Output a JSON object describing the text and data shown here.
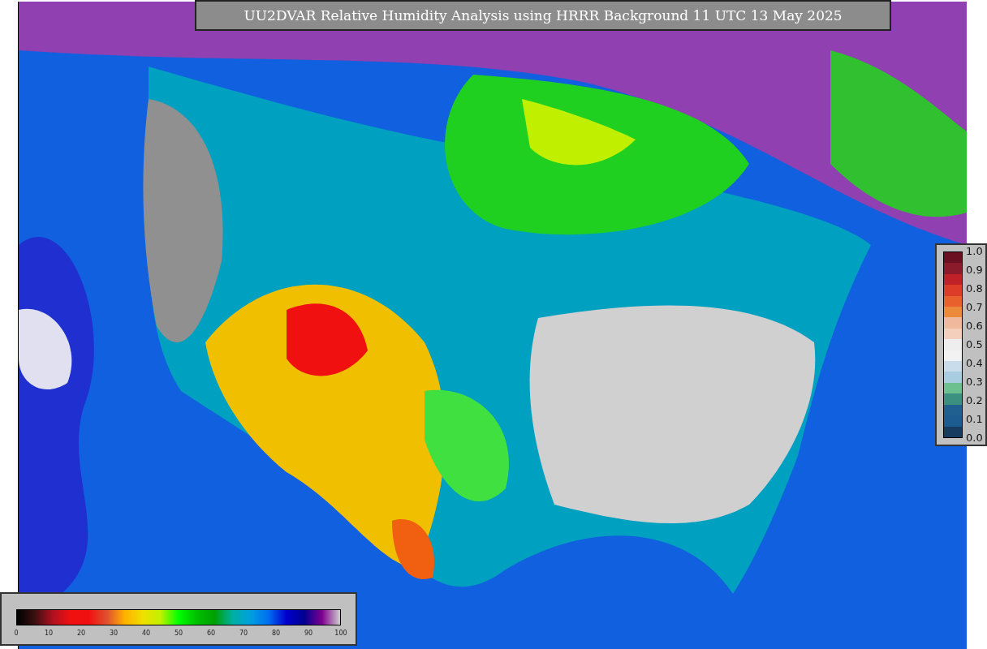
{
  "title": "UU2DVAR Relative Humidity Analysis using HRRR Background 11 UTC 13 May 2025",
  "humidity_legend": {
    "tick_labels": [
      "0",
      "10",
      "20",
      "30",
      "40",
      "50",
      "60",
      "70",
      "80",
      "90",
      "100"
    ]
  },
  "fraction_legend": {
    "tick_labels": [
      "1.0",
      "0.9",
      "0.8",
      "0.7",
      "0.6",
      "0.5",
      "0.4",
      "0.3",
      "0.2",
      "0.1",
      "0.0"
    ]
  }
}
